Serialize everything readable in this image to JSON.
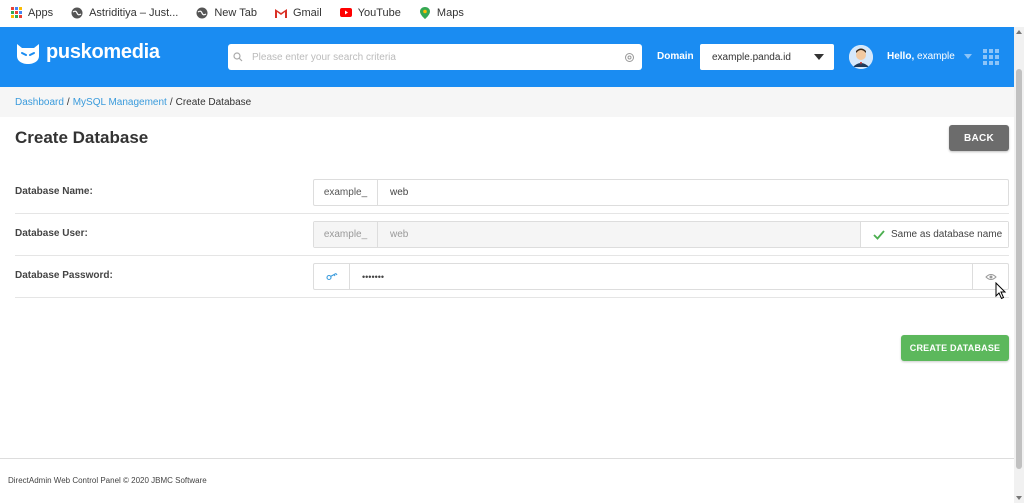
{
  "bookmarks": [
    {
      "label": "Apps",
      "icon": "apps-grid-icon"
    },
    {
      "label": "Astriditiya – Just...",
      "icon": "globe-icon"
    },
    {
      "label": "New Tab",
      "icon": "globe-icon"
    },
    {
      "label": "Gmail",
      "icon": "gmail-icon"
    },
    {
      "label": "YouTube",
      "icon": "youtube-icon"
    },
    {
      "label": "Maps",
      "icon": "maps-pin-icon"
    }
  ],
  "header": {
    "logo_text": "puskomedia",
    "search_placeholder": "Please enter your search criteria",
    "domain_label": "Domain",
    "domain_value": "example.panda.id",
    "hello_prefix": "Hello,",
    "hello_user": "example",
    "colors": {
      "header_bg": "#1a8cf2"
    }
  },
  "breadcrumb": {
    "items": [
      "Dashboard",
      "MySQL Management"
    ],
    "current": "Create Database",
    "separator": "/"
  },
  "page": {
    "title": "Create Database",
    "back_label": "BACK"
  },
  "form": {
    "db_name": {
      "label": "Database Name:",
      "prefix": "example_",
      "value": "web"
    },
    "db_user": {
      "label": "Database User:",
      "prefix": "example_",
      "value": "web",
      "same_as_label": "Same as database name",
      "same_checked": true
    },
    "db_password": {
      "label": "Database Password:",
      "value": "•••••••"
    }
  },
  "actions": {
    "create_label": "CREATE DATABASE",
    "create_color": "#5cb85c"
  },
  "footer": {
    "text": "DirectAdmin Web Control Panel © 2020 JBMC Software"
  }
}
